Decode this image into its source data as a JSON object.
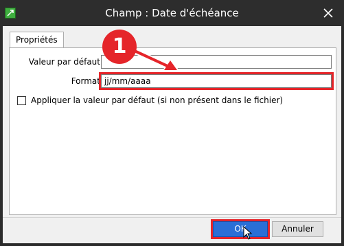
{
  "dialog": {
    "title": "Champ : Date d'échéance",
    "close_icon": "close-icon",
    "app_icon": "excel-export-icon"
  },
  "tabs": [
    {
      "label": "Propriétés",
      "selected": true
    }
  ],
  "form": {
    "default_value_label": "Valeur par défaut",
    "default_value": "",
    "format_label": "Format",
    "format_value": "jj/mm/aaaa",
    "apply_default_label": "Appliquer la valeur par défaut (si non présent dans le fichier)",
    "apply_default_checked": false
  },
  "buttons": {
    "ok": "OK",
    "cancel": "Annuler"
  },
  "annotation": {
    "step_number": "1",
    "highlight_color": "#e5252a"
  }
}
